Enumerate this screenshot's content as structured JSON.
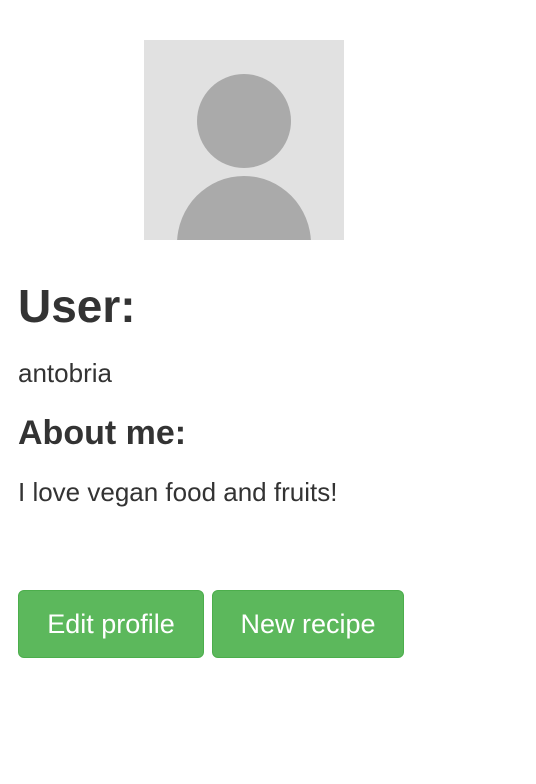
{
  "profile": {
    "avatar_icon": "user-silhouette-icon",
    "user_heading": "User:",
    "username": "antobria",
    "about_heading": "About me:",
    "about_text": "I love vegan food and fruits!"
  },
  "actions": {
    "edit_label": "Edit profile",
    "new_recipe_label": "New recipe"
  },
  "colors": {
    "button_green": "#5cb85c",
    "avatar_bg": "#e1e1e1",
    "avatar_figure": "#aaaaaa",
    "text": "#333333"
  }
}
